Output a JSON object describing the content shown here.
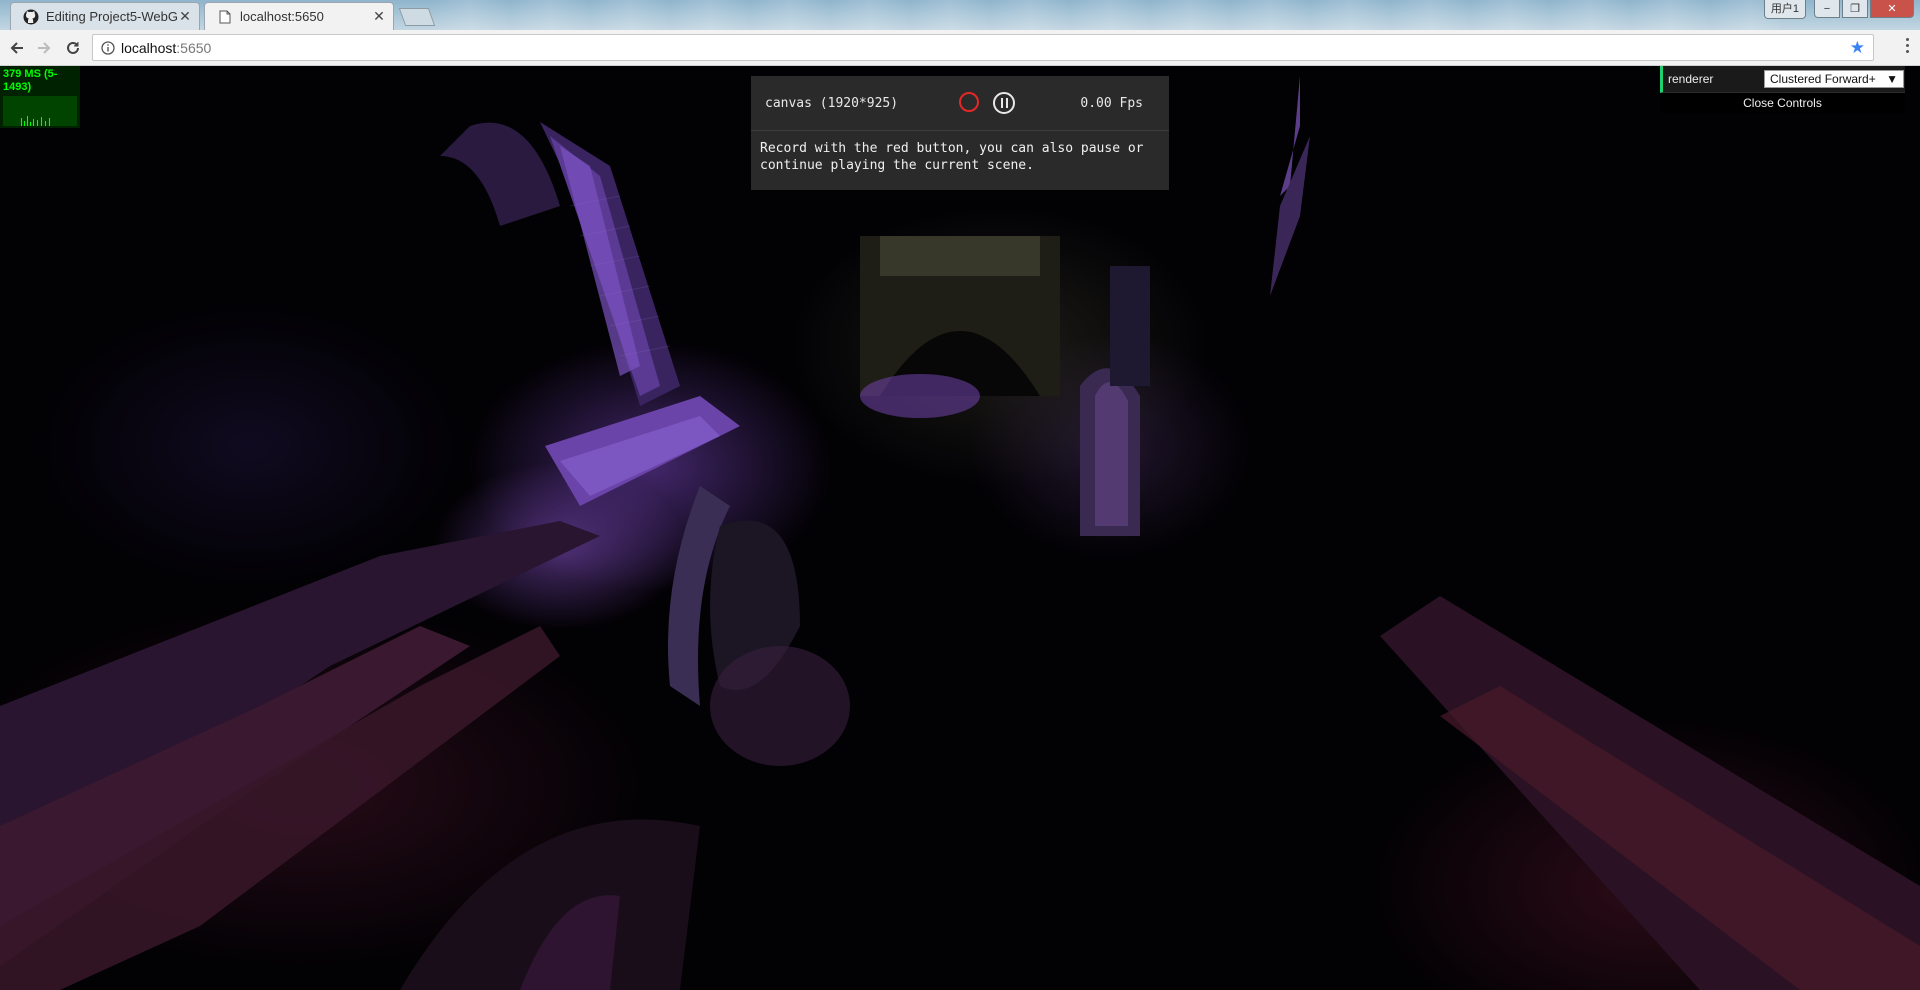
{
  "browser": {
    "tabs": [
      {
        "label": "Editing Project5-WebG",
        "icon": "github-icon",
        "active": false
      },
      {
        "label": "localhost:5650",
        "icon": "page-icon",
        "active": true
      }
    ],
    "window": {
      "user_label": "用户1",
      "minimize": "−",
      "maximize": "❐",
      "close": "✕"
    },
    "address": {
      "host": "localhost",
      "port": ":5650"
    }
  },
  "stats": {
    "text": "379 MS (5-1493)"
  },
  "capture": {
    "canvas_label": "canvas (1920*925)",
    "fps": "0.00 Fps",
    "info": "Record with the red button, you can also pause or continue playing the current scene.",
    "colors": {
      "record": "#e32828",
      "panel": "#2a2a2a"
    }
  },
  "gui": {
    "renderer_label": "renderer",
    "renderer_value": "Clustered Forward+",
    "close_label": "Close Controls",
    "accent": "#1ed36f"
  }
}
